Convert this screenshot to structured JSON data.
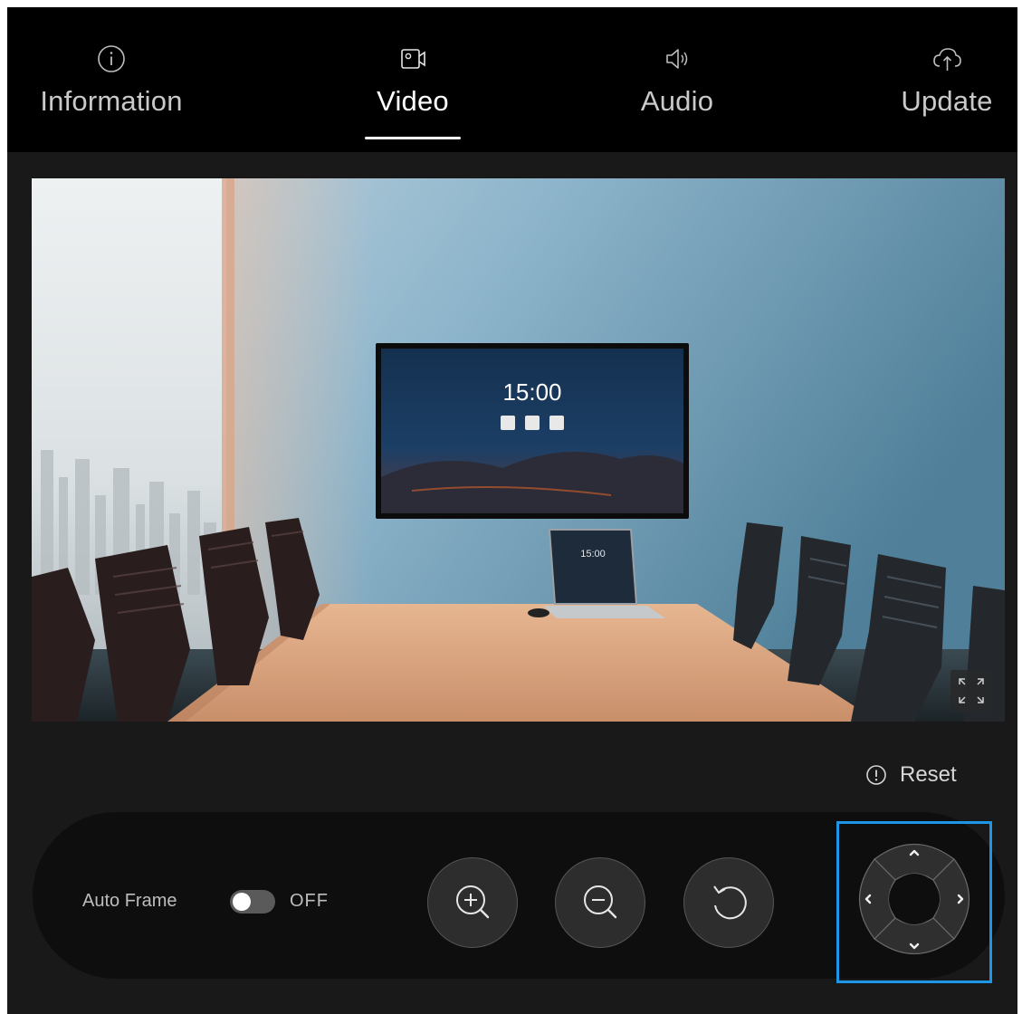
{
  "tabs": [
    {
      "label": "Information",
      "icon": "info-icon",
      "active": false
    },
    {
      "label": "Video",
      "icon": "video-camera-icon",
      "active": true
    },
    {
      "label": "Audio",
      "icon": "speaker-icon",
      "active": false
    },
    {
      "label": "Update",
      "icon": "cloud-upload-icon",
      "active": false
    }
  ],
  "preview": {
    "tv_time": "15:00",
    "laptop_time": "15:00",
    "expand_icon": "fullscreen-icon"
  },
  "reset": {
    "label": "Reset",
    "icon": "alert-circle-icon"
  },
  "auto_frame": {
    "label": "Auto Frame",
    "state": "OFF"
  },
  "controls": {
    "zoom_in_icon": "zoom-in-icon",
    "zoom_out_icon": "zoom-out-icon",
    "rotate_icon": "rotate-left-icon",
    "ptz": [
      "arrow-up-icon",
      "arrow-left-icon",
      "arrow-right-icon",
      "arrow-down-icon"
    ]
  },
  "colors": {
    "topbar": "#000000",
    "panel": "#191919",
    "accent_focus": "#1e96e6"
  }
}
